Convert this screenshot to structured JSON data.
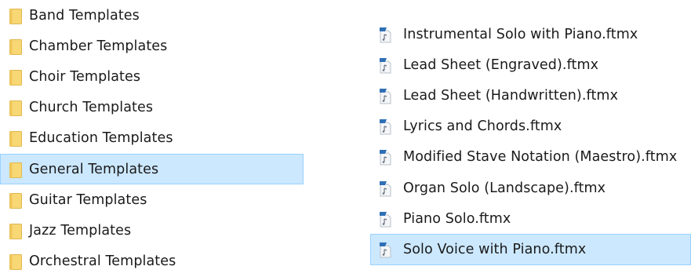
{
  "folders": [
    {
      "label": "Band Templates",
      "icon": "folder-icon",
      "selected": false
    },
    {
      "label": "Chamber Templates",
      "icon": "folder-icon",
      "selected": false
    },
    {
      "label": "Choir Templates",
      "icon": "folder-icon",
      "selected": false
    },
    {
      "label": "Church Templates",
      "icon": "folder-icon",
      "selected": false
    },
    {
      "label": "Education Templates",
      "icon": "folder-icon",
      "selected": false
    },
    {
      "label": "General Templates",
      "icon": "folder-icon",
      "selected": true
    },
    {
      "label": "Guitar Templates",
      "icon": "folder-icon",
      "selected": false
    },
    {
      "label": "Jazz Templates",
      "icon": "folder-icon",
      "selected": false
    },
    {
      "label": "Orchestral Templates",
      "icon": "folder-icon",
      "selected": false
    }
  ],
  "files": [
    {
      "label": "Instrumental Solo with Piano.ftmx",
      "icon": "finale-file-icon",
      "selected": false
    },
    {
      "label": "Lead Sheet (Engraved).ftmx",
      "icon": "finale-file-icon",
      "selected": false
    },
    {
      "label": "Lead Sheet (Handwritten).ftmx",
      "icon": "finale-file-icon",
      "selected": false
    },
    {
      "label": "Lyrics and Chords.ftmx",
      "icon": "finale-file-icon",
      "selected": false
    },
    {
      "label": "Modified Stave Notation (Maestro).ftmx",
      "icon": "finale-file-icon",
      "selected": false
    },
    {
      "label": "Organ Solo (Landscape).ftmx",
      "icon": "finale-file-icon",
      "selected": false
    },
    {
      "label": "Piano Solo.ftmx",
      "icon": "finale-file-icon",
      "selected": false
    },
    {
      "label": "Solo Voice with Piano.ftmx",
      "icon": "finale-file-icon",
      "selected": true
    }
  ],
  "colors": {
    "selection_fill": "#cce8ff",
    "selection_border": "#99d1ff",
    "folder_fill": "#f8d775",
    "file_icon_blue": "#2f6fb5"
  }
}
